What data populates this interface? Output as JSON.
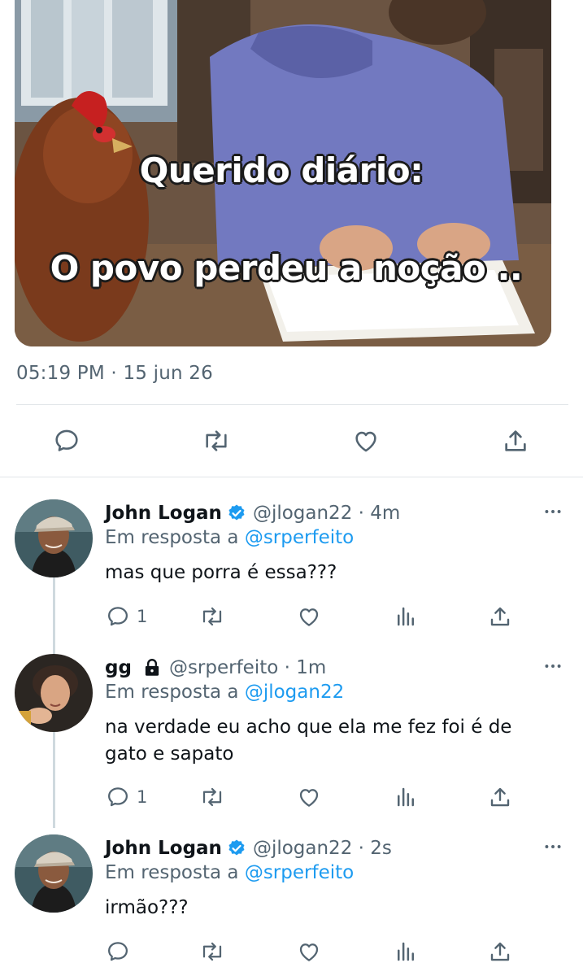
{
  "media": {
    "caption_line1": "Querido diário:",
    "caption_line2": "O povo perdeu a noção .."
  },
  "tweet": {
    "timestamp": "05:19 PM · 15 jun 26"
  },
  "colors": {
    "link": "#1d9bf0",
    "secondary_text": "#536471",
    "primary_text": "#0f1419",
    "divider": "#e1e5e9"
  },
  "replies": [
    {
      "name": "John Logan",
      "verified": true,
      "handle": "@jlogan22 · 4m",
      "reply_to_prefix": "Em resposta a",
      "reply_to": "@srperfeito",
      "text": "mas que porra é essa???",
      "reply_count": "1"
    },
    {
      "name": "gg",
      "locked": true,
      "handle": "@srperfeito · 1m",
      "reply_to_prefix": "Em resposta a",
      "reply_to": "@jlogan22",
      "text": "na verdade eu acho que ela me fez foi é de gato e sapato",
      "reply_count": "1"
    },
    {
      "name": "John Logan",
      "verified": true,
      "handle": "@jlogan22 · 2s",
      "reply_to_prefix": "Em resposta a",
      "reply_to": "@srperfeito",
      "text": "irmão???",
      "reply_count": ""
    }
  ],
  "icons": {
    "reply": "reply-icon",
    "retweet": "retweet-icon",
    "like": "heart-icon",
    "views": "analytics-icon",
    "share": "share-icon",
    "more": "more-icon",
    "verified": "verified-badge-icon",
    "lock": "lock-icon"
  }
}
